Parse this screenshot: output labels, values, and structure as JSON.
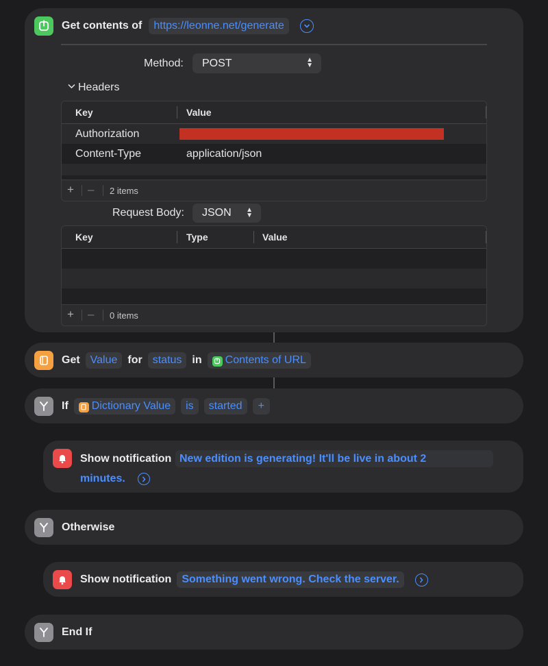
{
  "get_contents": {
    "title": "Get contents of",
    "url": "https://leonne.net/generate",
    "method_label": "Method:",
    "method_value": "POST",
    "headers_label": "Headers",
    "headers_table": {
      "columns": [
        "Key",
        "Value"
      ],
      "rows": [
        {
          "key": "Authorization",
          "value": ""
        },
        {
          "key": "Content-Type",
          "value": "application/json"
        }
      ],
      "count": "2 items"
    },
    "body_label": "Request Body:",
    "body_value": "JSON",
    "body_table": {
      "columns": [
        "Key",
        "Type",
        "Value"
      ],
      "count": "0 items"
    }
  },
  "get_value": {
    "get": "Get",
    "value_token": "Value",
    "for": "for",
    "key_token": "status",
    "in": "in",
    "source_token": "Contents of URL"
  },
  "if_action": {
    "title": "If",
    "var_token": "Dictionary Value",
    "op_token": "is",
    "val_token": "started",
    "add": "+"
  },
  "notif1": {
    "title": "Show notification",
    "line1": "New edition is generating! It'll be live in about 2",
    "line2": "minutes."
  },
  "otherwise": {
    "title": "Otherwise"
  },
  "notif2": {
    "title": "Show notification",
    "text": "Something went wrong. Check the server."
  },
  "end_if": {
    "title": "End If"
  },
  "colors": {
    "accent": "#4a8eff",
    "url_icon": "#4cc85e",
    "dict_icon": "#f5a142",
    "control_icon": "#8e8e93",
    "notify_icon": "#ea4a4a",
    "redaction": "#c23122"
  },
  "icons": [
    "power-icon",
    "book-icon",
    "branch-icon",
    "bell-icon",
    "chevron-down-icon",
    "chevron-right-icon"
  ]
}
